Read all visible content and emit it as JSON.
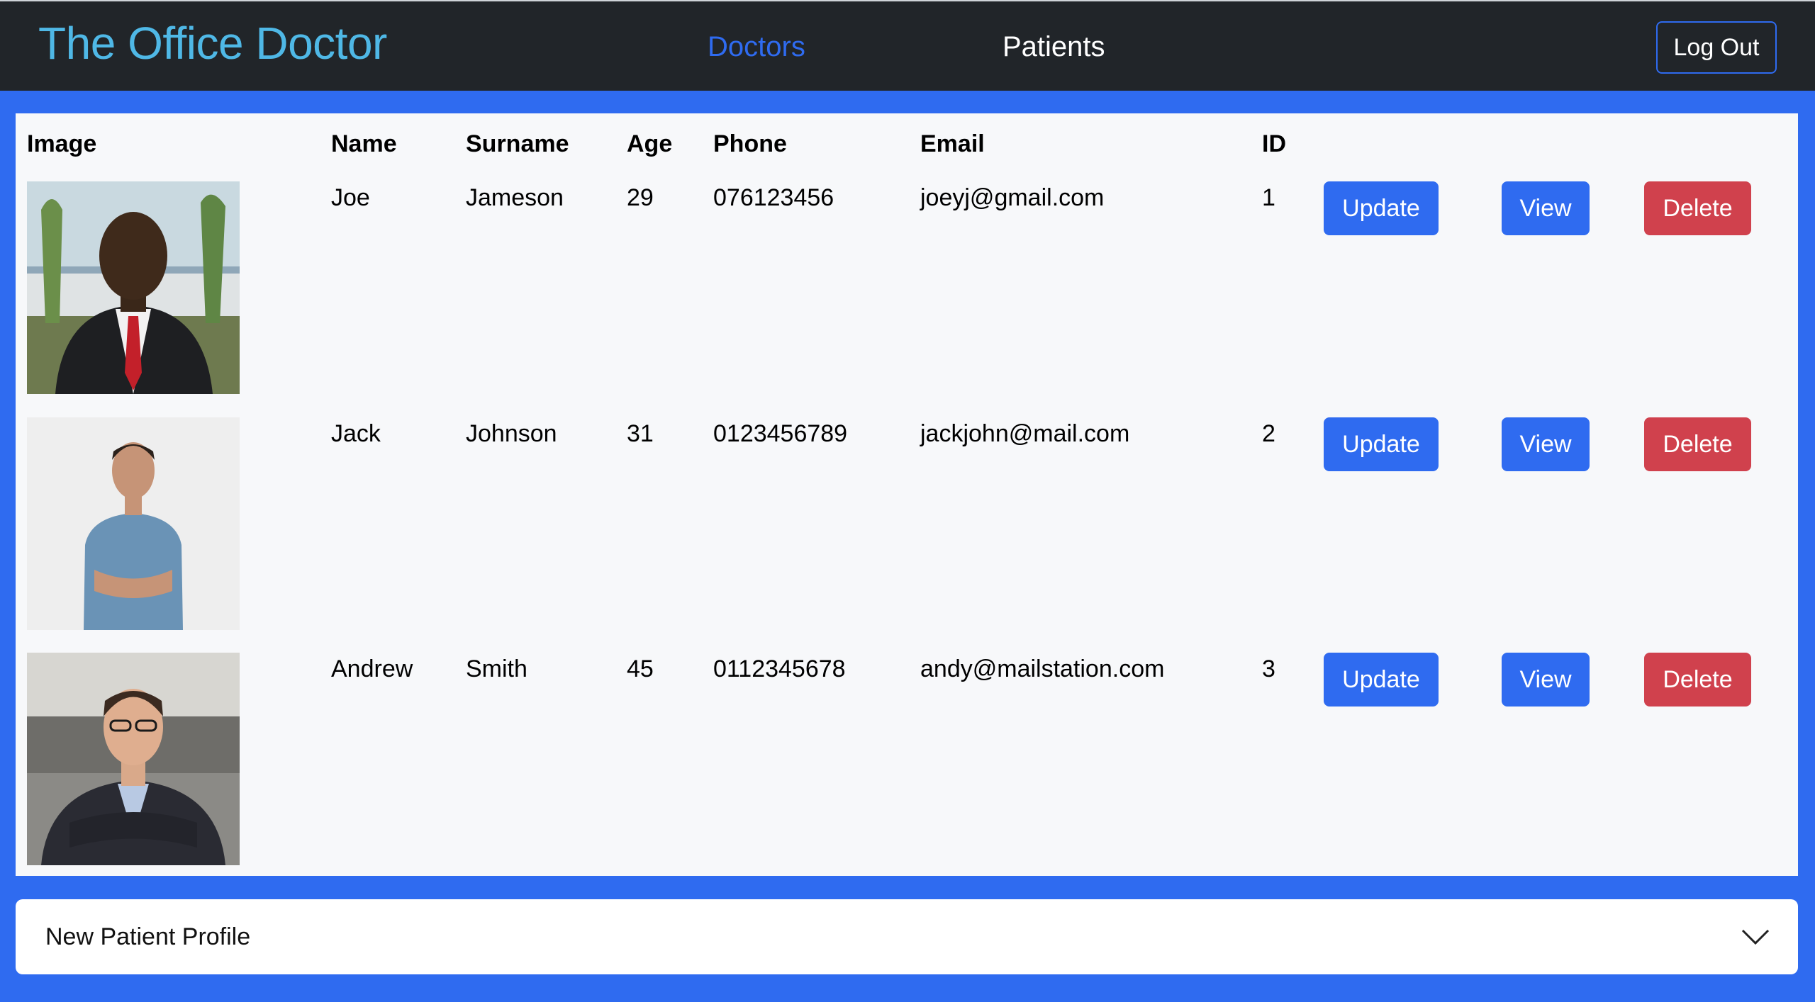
{
  "header": {
    "brand": "The Office Doctor",
    "nav": {
      "doctors": "Doctors",
      "patients": "Patients"
    },
    "logout_label": "Log Out",
    "brand_color": "#4fb8e6",
    "active_link_color": "#2f6bf0"
  },
  "table": {
    "columns": {
      "image": "Image",
      "name": "Name",
      "surname": "Surname",
      "age": "Age",
      "phone": "Phone",
      "email": "Email",
      "id": "ID"
    },
    "rows": [
      {
        "name": "Joe",
        "surname": "Jameson",
        "age": "29",
        "phone": "076123456",
        "email": "joeyj@gmail.com",
        "id": "1",
        "update": "Update",
        "view": "View",
        "delete": "Delete"
      },
      {
        "name": "Jack",
        "surname": "Johnson",
        "age": "31",
        "phone": "0123456789",
        "email": "jackjohn@mail.com",
        "id": "2",
        "update": "Update",
        "view": "View",
        "delete": "Delete"
      },
      {
        "name": "Andrew",
        "surname": "Smith",
        "age": "45",
        "phone": "0112345678",
        "email": "andy@mailstation.com",
        "id": "3",
        "update": "Update",
        "view": "View",
        "delete": "Delete"
      }
    ]
  },
  "accordion": {
    "label": "New Patient Profile",
    "icon": "chevron-down-icon"
  },
  "colors": {
    "primary": "#2f6bf0",
    "danger": "#d0414d",
    "navbar": "#212529"
  }
}
